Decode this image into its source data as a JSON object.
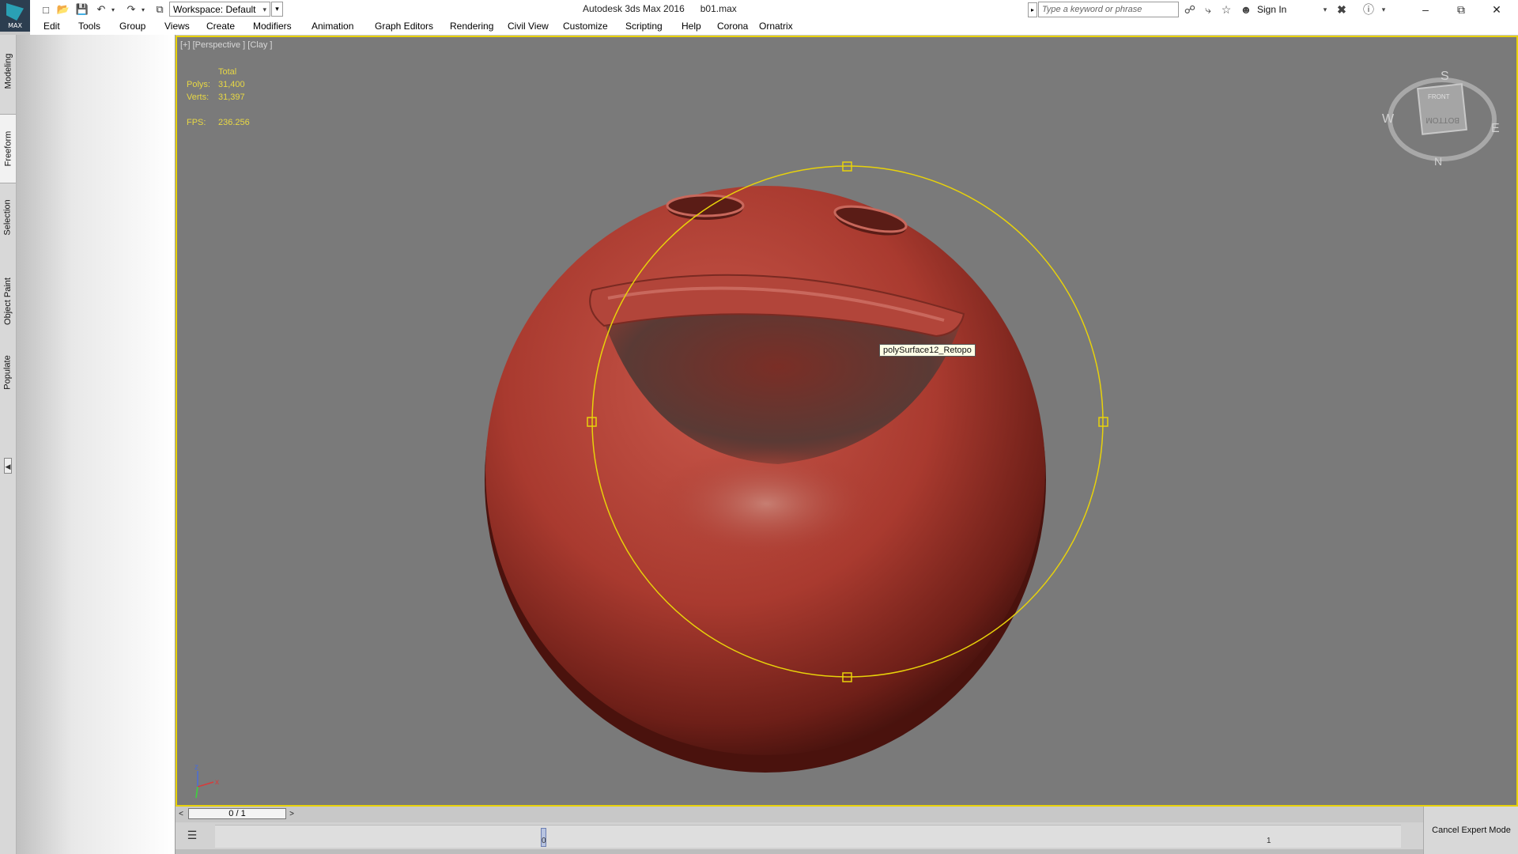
{
  "titlebar": {
    "app_logo_label": "MAX",
    "workspace": "Workspace: Default",
    "title": "Autodesk 3ds Max 2016      b01.max",
    "search_placeholder": "Type a keyword or phrase",
    "sign_in": "Sign In"
  },
  "menu": [
    "Edit",
    "Tools",
    "Group",
    "Views",
    "Create",
    "Modifiers",
    "Animation",
    "Graph Editors",
    "Rendering",
    "Civil View",
    "Customize",
    "Scripting",
    "Help",
    "Corona",
    "Ornatrix"
  ],
  "ribbon_tabs": [
    "Modeling",
    "Freeform",
    "Selection",
    "Object Paint",
    "Populate"
  ],
  "viewport": {
    "label": "[+] [Perspective ] [Clay ]",
    "stats": {
      "header": "Total",
      "polys_label": "Polys:",
      "polys": "31,400",
      "verts_label": "Verts:",
      "verts": "31,397",
      "fps_label": "FPS:",
      "fps": "236.256"
    },
    "tooltip": "polySurface12_Retopo",
    "viewcube": {
      "top": "S",
      "bottom": "N",
      "left": "W",
      "right": "E",
      "face_front": "FRONT",
      "face_bottom": "BOTTOM"
    },
    "axis": {
      "z": "z",
      "x": "x"
    }
  },
  "timeline": {
    "frame": "0 / 1",
    "prev": "<",
    "next": ">",
    "track_start": "0",
    "track_end": "1"
  },
  "expert_mode_button": "Cancel Expert Mode",
  "colors": {
    "viewport_bg": "#7a7a7a",
    "selection_yellow": "#e8d20a",
    "sphere_red": "#b9463a"
  }
}
